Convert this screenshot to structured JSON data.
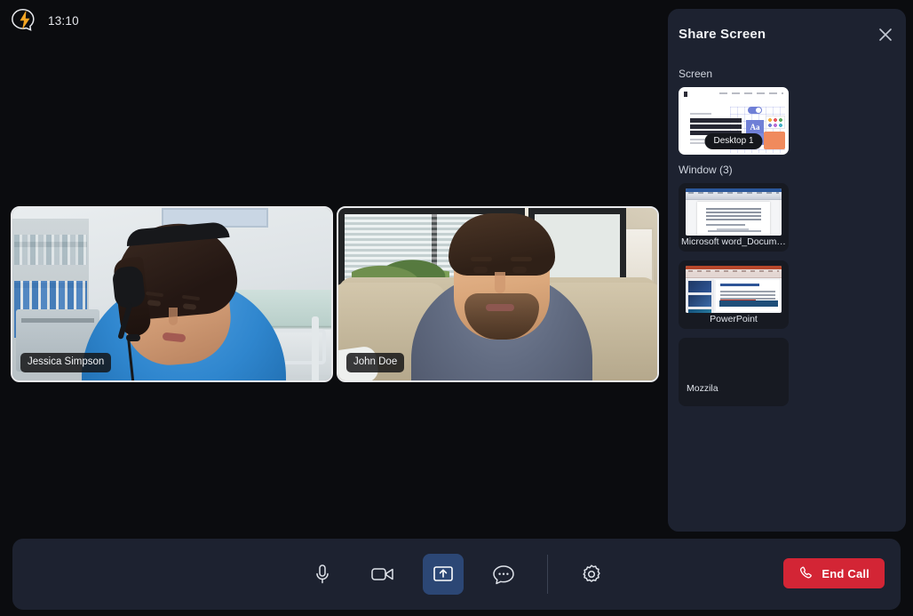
{
  "app": {
    "background_color": "#0b0c0f",
    "panel_color": "#1d2230",
    "accent_color": "#2c4775",
    "danger_color": "#d32535",
    "logo_color": "#f5a623"
  },
  "topbar": {
    "logo_icon": "chat-bolt-logo-icon",
    "clock": "13:10"
  },
  "stage": {
    "participants": [
      {
        "name": "Jessica Simpson",
        "scene": "nurse-hospital-room"
      },
      {
        "name": "John Doe",
        "scene": "man-living-room-couch"
      }
    ]
  },
  "share_panel": {
    "title": "Share Screen",
    "close_icon": "close-icon",
    "screen_section": {
      "label": "Screen",
      "items": [
        {
          "label": "Desktop 1",
          "preview": "design-system-website"
        }
      ]
    },
    "window_section": {
      "label": "Window (3)",
      "items": [
        {
          "label": "Microsoft word_Document",
          "preview": "word-document"
        },
        {
          "label": "PowerPoint",
          "preview": "powerpoint-slides"
        },
        {
          "label": "Mozzila",
          "preview": "blank"
        }
      ]
    }
  },
  "toolbar": {
    "buttons": [
      {
        "name": "microphone",
        "icon": "microphone-icon",
        "active": false
      },
      {
        "name": "camera",
        "icon": "video-camera-icon",
        "active": false
      },
      {
        "name": "share-screen",
        "icon": "share-screen-icon",
        "active": true
      },
      {
        "name": "chat",
        "icon": "chat-bubble-icon",
        "active": false
      },
      {
        "name": "settings",
        "icon": "gear-icon",
        "active": false
      }
    ],
    "end_call": {
      "label": "End Call",
      "icon": "phone-hangup-icon"
    }
  }
}
